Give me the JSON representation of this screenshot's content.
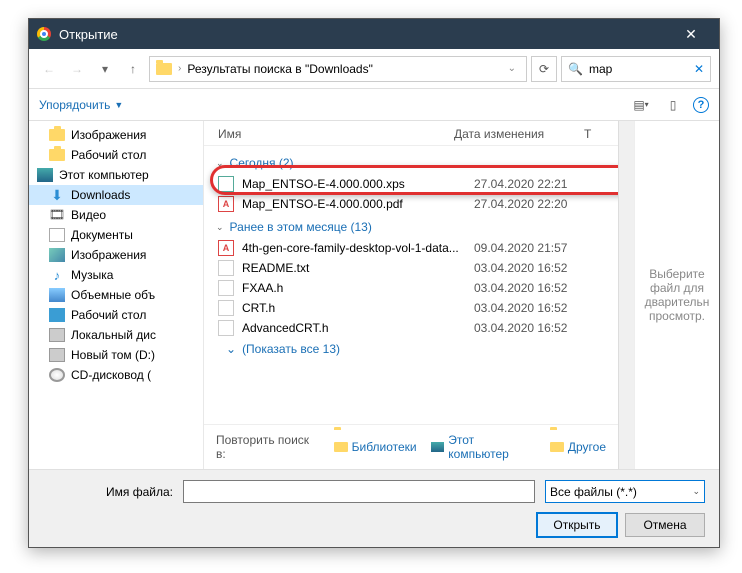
{
  "title": "Открытие",
  "breadcrumb": {
    "label": "Результаты поиска в \"Downloads\""
  },
  "search": {
    "value": "map"
  },
  "toolbar": {
    "organize": "Упорядочить"
  },
  "sidebar": {
    "items": [
      {
        "label": "Изображения",
        "icon": "folder"
      },
      {
        "label": "Рабочий стол",
        "icon": "folder"
      },
      {
        "label": "Этот компьютер",
        "icon": "pc",
        "group": true
      },
      {
        "label": "Downloads",
        "icon": "dl",
        "active": true
      },
      {
        "label": "Видео",
        "icon": "vid"
      },
      {
        "label": "Документы",
        "icon": "doc"
      },
      {
        "label": "Изображения",
        "icon": "img"
      },
      {
        "label": "Музыка",
        "icon": "mus"
      },
      {
        "label": "Объемные объ",
        "icon": "obj"
      },
      {
        "label": "Рабочий стол",
        "icon": "desk"
      },
      {
        "label": "Локальный дис",
        "icon": "disk"
      },
      {
        "label": "Новый том (D:)",
        "icon": "disk"
      },
      {
        "label": "CD-дисковод (",
        "icon": "cd"
      }
    ]
  },
  "columns": {
    "name": "Имя",
    "date": "Дата изменения",
    "type": "Т"
  },
  "groups": [
    {
      "header": "Сегодня (2)",
      "files": [
        {
          "name": "Map_ENTSO-E-4.000.000.xps",
          "date": "27.04.2020 22:21",
          "icon": "xps",
          "highlighted": true
        },
        {
          "name": "Map_ENTSO-E-4.000.000.pdf",
          "date": "27.04.2020 22:20",
          "icon": "pdf"
        }
      ]
    },
    {
      "header": "Ранее в этом месяце (13)",
      "files": [
        {
          "name": "4th-gen-core-family-desktop-vol-1-data...",
          "date": "09.04.2020 21:57",
          "icon": "pdf"
        },
        {
          "name": "README.txt",
          "date": "03.04.2020 16:52",
          "icon": "txt"
        },
        {
          "name": "FXAA.h",
          "date": "03.04.2020 16:52",
          "icon": "txt"
        },
        {
          "name": "CRT.h",
          "date": "03.04.2020 16:52",
          "icon": "txt"
        },
        {
          "name": "AdvancedCRT.h",
          "date": "03.04.2020 16:52",
          "icon": "txt"
        }
      ],
      "show_all": "(Показать все 13)"
    }
  ],
  "repeat_search": {
    "label": "Повторить поиск в:",
    "links": [
      "Библиотеки",
      "Этот компьютер",
      "Другое"
    ]
  },
  "preview": {
    "text": "Выберите файл для дварительн просмотр."
  },
  "footer": {
    "filename_label": "Имя файла:",
    "filename_value": "",
    "filter": "Все файлы (*.*)",
    "open": "Открыть",
    "cancel": "Отмена"
  }
}
